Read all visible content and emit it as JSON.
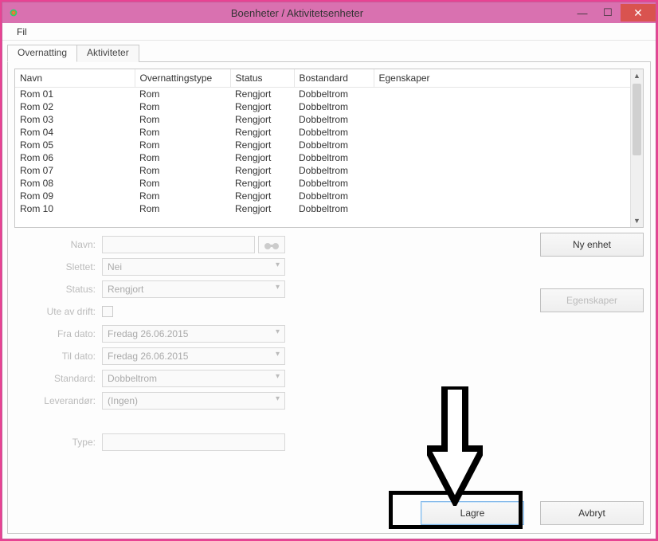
{
  "window": {
    "title": "Boenheter / Aktivitetsenheter"
  },
  "menu": {
    "file": "Fil"
  },
  "tabs": {
    "lodging": "Overnatting",
    "activities": "Aktiviteter"
  },
  "columns": {
    "name": "Navn",
    "type": "Overnattingstype",
    "status": "Status",
    "standard": "Bostandard",
    "properties": "Egenskaper"
  },
  "rows": [
    {
      "name": "Rom 01",
      "type": "Rom",
      "status": "Rengjort",
      "standard": "Dobbeltrom",
      "properties": ""
    },
    {
      "name": "Rom 02",
      "type": "Rom",
      "status": "Rengjort",
      "standard": "Dobbeltrom",
      "properties": ""
    },
    {
      "name": "Rom 03",
      "type": "Rom",
      "status": "Rengjort",
      "standard": "Dobbeltrom",
      "properties": ""
    },
    {
      "name": "Rom 04",
      "type": "Rom",
      "status": "Rengjort",
      "standard": "Dobbeltrom",
      "properties": ""
    },
    {
      "name": "Rom 05",
      "type": "Rom",
      "status": "Rengjort",
      "standard": "Dobbeltrom",
      "properties": ""
    },
    {
      "name": "Rom 06",
      "type": "Rom",
      "status": "Rengjort",
      "standard": "Dobbeltrom",
      "properties": ""
    },
    {
      "name": "Rom 07",
      "type": "Rom",
      "status": "Rengjort",
      "standard": "Dobbeltrom",
      "properties": ""
    },
    {
      "name": "Rom 08",
      "type": "Rom",
      "status": "Rengjort",
      "standard": "Dobbeltrom",
      "properties": ""
    },
    {
      "name": "Rom 09",
      "type": "Rom",
      "status": "Rengjort",
      "standard": "Dobbeltrom",
      "properties": ""
    },
    {
      "name": "Rom 10",
      "type": "Rom",
      "status": "Rengjort",
      "standard": "Dobbeltrom",
      "properties": ""
    }
  ],
  "form": {
    "labels": {
      "name": "Navn:",
      "deleted": "Slettet:",
      "status": "Status:",
      "out_of_service": "Ute av drift:",
      "from_date": "Fra dato:",
      "to_date": "Til dato:",
      "standard": "Standard:",
      "supplier": "Leverandør:",
      "type": "Type:"
    },
    "values": {
      "name": "",
      "deleted": "Nei",
      "status": "Rengjort",
      "from_date": "Fredag 26.06.2015",
      "to_date": "Fredag 26.06.2015",
      "standard": "Dobbeltrom",
      "supplier": "(Ingen)",
      "type": ""
    }
  },
  "buttons": {
    "new_unit": "Ny enhet",
    "properties": "Egenskaper",
    "save": "Lagre",
    "cancel": "Avbryt"
  }
}
